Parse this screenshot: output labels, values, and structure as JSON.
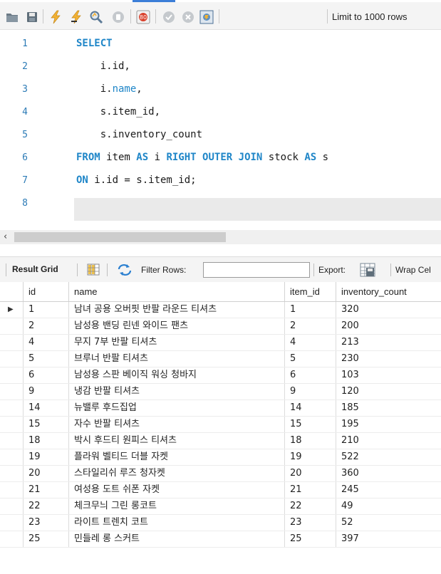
{
  "toolbar": {
    "icons": [
      "folder-icon",
      "save-icon",
      "execute-icon",
      "execute-current-icon",
      "explain-icon",
      "stop-icon",
      "stop-on-error-icon",
      "commit-icon",
      "rollback-icon",
      "autocommit-icon"
    ],
    "limit_label": "Limit to 1000 rows"
  },
  "editor": {
    "lines": [
      {
        "no": "1",
        "text": "SELECT"
      },
      {
        "no": "2",
        "text": "    i.id,"
      },
      {
        "no": "3",
        "text": "    i.name,"
      },
      {
        "no": "4",
        "text": "    s.item_id,"
      },
      {
        "no": "5",
        "text": "    s.inventory_count"
      },
      {
        "no": "6",
        "text": "FROM item AS i RIGHT OUTER JOIN stock AS s"
      },
      {
        "no": "7",
        "text": "ON i.id = s.item_id;"
      },
      {
        "no": "8",
        "text": ""
      }
    ]
  },
  "result_toolbar": {
    "result_grid_label": "Result Grid",
    "filter_label": "Filter Rows:",
    "filter_value": "",
    "export_label": "Export:",
    "wrap_label": "Wrap Cel"
  },
  "grid": {
    "columns": [
      "id",
      "name",
      "item_id",
      "inventory_count"
    ],
    "rows": [
      [
        "1",
        "남녀 공용 오버핏 반팔 라운드 티셔츠",
        "1",
        "320"
      ],
      [
        "2",
        "남성용 밴딩 린넨 와이드 팬츠",
        "2",
        "200"
      ],
      [
        "4",
        "무지 7부 반팔 티셔츠",
        "4",
        "213"
      ],
      [
        "5",
        "브루너 반팔 티셔츠",
        "5",
        "230"
      ],
      [
        "6",
        "남성용 스판 베이직 워싱 청바지",
        "6",
        "103"
      ],
      [
        "9",
        "냉감 반팔 티셔츠",
        "9",
        "120"
      ],
      [
        "14",
        "뉴밸루 후드집업",
        "14",
        "185"
      ],
      [
        "15",
        "자수 반팔 티셔츠",
        "15",
        "195"
      ],
      [
        "18",
        "박시 후드티 원피스 티셔츠",
        "18",
        "210"
      ],
      [
        "19",
        "플라워 벨티드 더블 자켓",
        "19",
        "522"
      ],
      [
        "20",
        "스타일리쉬 루즈 청자켓",
        "20",
        "360"
      ],
      [
        "21",
        "여성용 도트 쉬폰 자켓",
        "21",
        "245"
      ],
      [
        "22",
        "체크무늬 그린 롱코트",
        "22",
        "49"
      ],
      [
        "23",
        "라이트 트렌치 코트",
        "23",
        "52"
      ],
      [
        "25",
        "민들레 롱 스커트",
        "25",
        "397"
      ]
    ]
  },
  "colors": {
    "keyword": "#1f86c8",
    "line_number": "#2c7bb6"
  }
}
